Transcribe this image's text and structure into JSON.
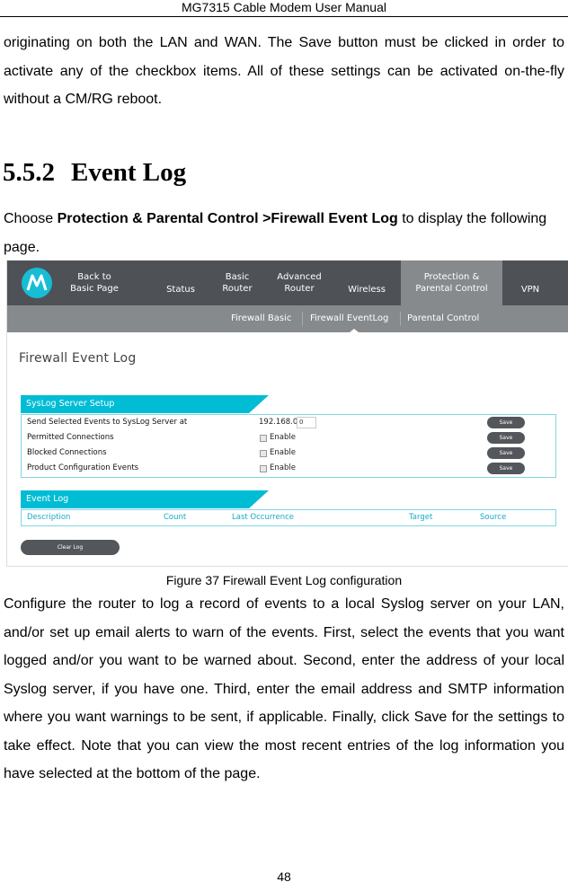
{
  "header": {
    "title": "MG7315 Cable Modem User Manual"
  },
  "intro_paragraph": "originating on both the LAN and WAN. The Save button must be clicked in order to activate any of the checkbox items. All of these settings can be activated on-the-fly without a CM/RG reboot.",
  "section": {
    "number": "5.5.2",
    "title": "Event Log"
  },
  "choose_text": {
    "prefix": "Choose ",
    "bold": "Protection & Parental Control >Firewall Event Log",
    "suffix": " to display the following page."
  },
  "screenshot": {
    "logo": "motorola-logo",
    "top_nav": [
      {
        "label": "Back to\nBasic Page",
        "active": false
      },
      {
        "label": "Status",
        "active": false
      },
      {
        "label": "Basic\nRouter",
        "active": false
      },
      {
        "label": "Advanced\nRouter",
        "active": false
      },
      {
        "label": "Wireless",
        "active": false
      },
      {
        "label": "Protection &\nParental Control",
        "active": true
      },
      {
        "label": "VPN",
        "active": false
      }
    ],
    "sub_nav": [
      {
        "label": "Firewall Basic",
        "active": false
      },
      {
        "label": "Firewall EventLog",
        "active": true
      },
      {
        "label": "Parental Control",
        "active": false
      }
    ],
    "page_heading": "Firewall Event Log",
    "syslog_card": {
      "title": "SysLog Server Setup",
      "rows": [
        {
          "label": "Send Selected Events to SysLog Server at",
          "ip_prefix": "192.168.0.",
          "ip_value": "0",
          "save": "Save"
        },
        {
          "label": "Permitted Connections",
          "checkbox_label": "Enable",
          "checked": false,
          "save": "Save"
        },
        {
          "label": "Blocked Connections",
          "checkbox_label": "Enable",
          "checked": false,
          "save": "Save"
        },
        {
          "label": "Product Configuration Events",
          "checkbox_label": "Enable",
          "checked": false,
          "save": "Save"
        }
      ]
    },
    "event_log_card": {
      "title": "Event Log",
      "columns": [
        "Description",
        "Count",
        "Last Occurrence",
        "Target",
        "Source"
      ]
    },
    "clear_log_button": "Clear Log"
  },
  "caption": "Figure 37 Firewall Event Log configuration",
  "body_paragraph": "Configure the router to log a record of events to a local Syslog server on your LAN, and/or set up email alerts to warn of the events. First, select the events that you want logged and/or you want to be warned about. Second, enter the address of your local Syslog server, if you have one. Third, enter the email address and SMTP information where you want warnings to be sent, if applicable. Finally, click Save for the settings to take effect. Note that you can view the most recent entries of the log information you have selected at the bottom of the page.",
  "page_number": "48"
}
